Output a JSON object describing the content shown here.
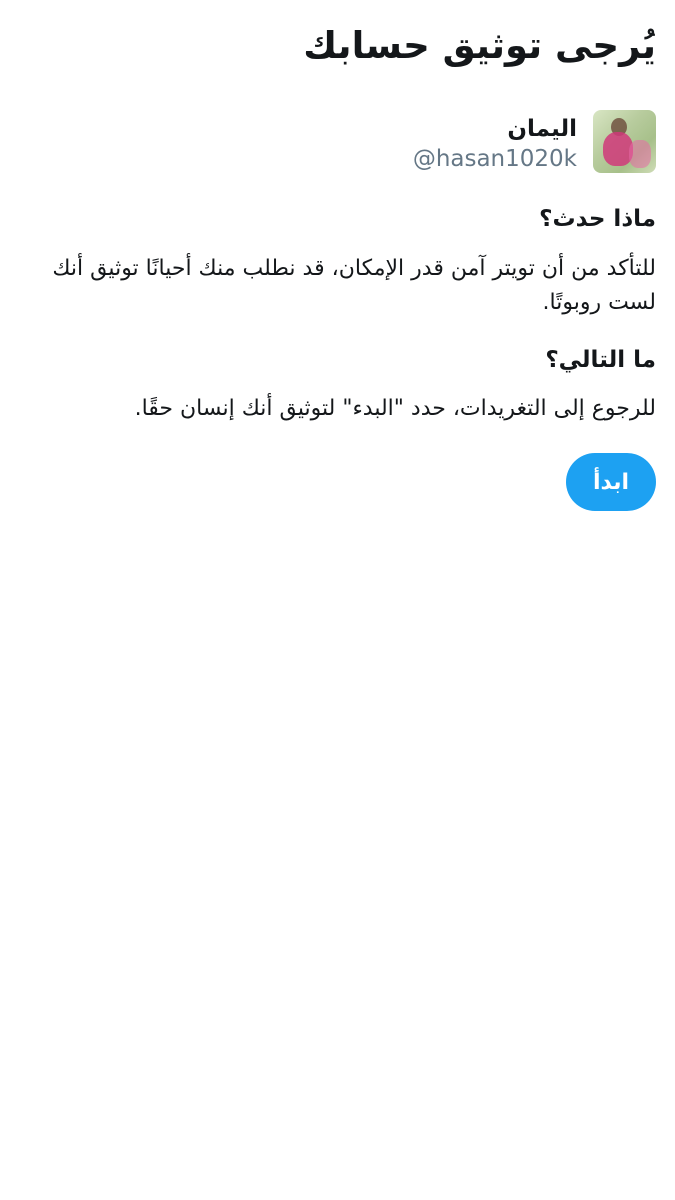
{
  "page": {
    "title": "يُرجى توثيق حسابك"
  },
  "account": {
    "display_name": "اليمان",
    "handle": "@hasan1020k",
    "avatar_icon": "user-avatar-photo"
  },
  "what_happened": {
    "heading": "ماذا حدث؟",
    "body": "للتأكد من أن تويتر آمن قدر الإمكان، قد نطلب منك أحيانًا توثيق أنك لست روبوتًا."
  },
  "whats_next": {
    "heading": "ما التالي؟",
    "body": "للرجوع إلى التغريدات، حدد \"البدء\" لتوثيق أنك إنسان حقًا."
  },
  "actions": {
    "start_label": "ابدأ"
  },
  "colors": {
    "accent": "#1da1f2",
    "text_primary": "#14171a",
    "text_secondary": "#657786",
    "background": "#ffffff"
  }
}
